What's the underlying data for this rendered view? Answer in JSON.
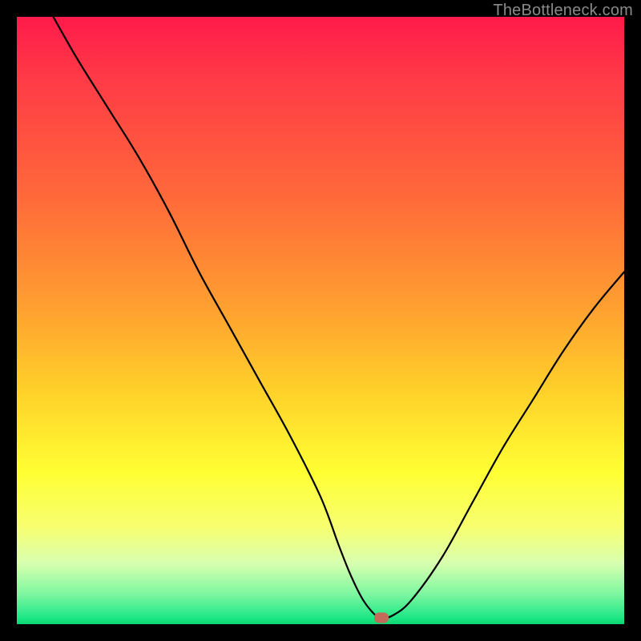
{
  "watermark": "TheBottleneck.com",
  "chart_data": {
    "type": "line",
    "title": "",
    "xlabel": "",
    "ylabel": "",
    "xlim": [
      0,
      100
    ],
    "ylim": [
      0,
      100
    ],
    "grid": false,
    "legend": false,
    "series": [
      {
        "name": "bottleneck-curve",
        "x": [
          6,
          10,
          15,
          20,
          25,
          30,
          35,
          40,
          45,
          50,
          53,
          55,
          57,
          59,
          60,
          62,
          65,
          70,
          75,
          80,
          85,
          90,
          95,
          100
        ],
        "y": [
          100,
          93,
          85,
          77,
          68,
          58,
          49,
          40,
          31,
          21,
          13,
          8,
          4,
          1.5,
          1,
          1.5,
          4,
          11,
          20,
          29,
          37,
          45,
          52,
          58
        ]
      }
    ],
    "marker": {
      "x": 60,
      "y": 1
    },
    "background_gradient_stops": [
      {
        "pos": 0,
        "color": "#ff1a4b"
      },
      {
        "pos": 30,
        "color": "#ff6a3a"
      },
      {
        "pos": 62,
        "color": "#ffd22a"
      },
      {
        "pos": 84,
        "color": "#f7ff70"
      },
      {
        "pos": 99,
        "color": "#1de786"
      },
      {
        "pos": 100,
        "color": "#0cd46e"
      }
    ]
  }
}
